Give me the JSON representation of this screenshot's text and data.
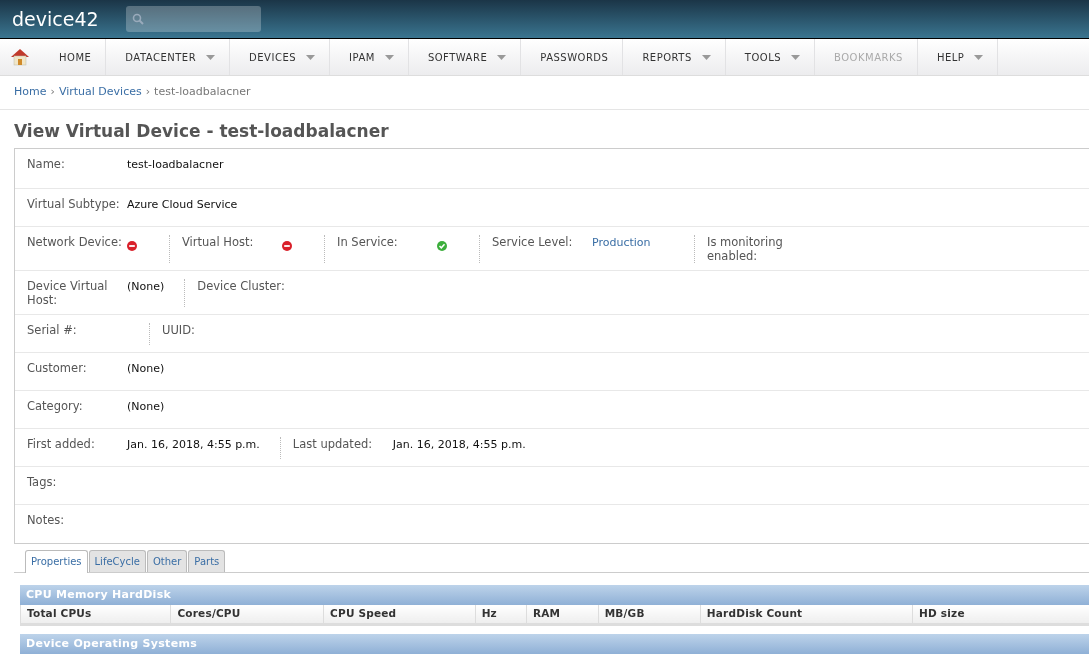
{
  "header": {
    "logo": "device42"
  },
  "nav": [
    {
      "label": "HOME",
      "dropdown": false,
      "disabled": false
    },
    {
      "label": "DATACENTER",
      "dropdown": true,
      "disabled": false
    },
    {
      "label": "DEVICES",
      "dropdown": true,
      "disabled": false
    },
    {
      "label": "IPAM",
      "dropdown": true,
      "disabled": false
    },
    {
      "label": "SOFTWARE",
      "dropdown": true,
      "disabled": false
    },
    {
      "label": "PASSWORDS",
      "dropdown": false,
      "disabled": false
    },
    {
      "label": "REPORTS",
      "dropdown": true,
      "disabled": false
    },
    {
      "label": "TOOLS",
      "dropdown": true,
      "disabled": false
    },
    {
      "label": "BOOKMARKS",
      "dropdown": false,
      "disabled": true
    },
    {
      "label": "HELP",
      "dropdown": true,
      "disabled": false
    }
  ],
  "breadcrumb": [
    {
      "label": "Home",
      "kind": "link"
    },
    {
      "label": "›",
      "kind": "separator"
    },
    {
      "label": "Virtual Devices",
      "kind": "link"
    },
    {
      "label": "›",
      "kind": "separator"
    },
    {
      "label": "test-loadbalacner",
      "kind": "current"
    }
  ],
  "title": "View Virtual Device - test-loadbalacner",
  "field_rows": [
    [
      {
        "label": "Name:",
        "kind": "text",
        "value": "test-loadbalacner"
      }
    ],
    [
      {
        "label": "Virtual Subtype:",
        "kind": "text",
        "value": "Azure Cloud Service"
      }
    ],
    [
      {
        "label": "Network Device:",
        "kind": "flag",
        "on": false
      },
      {
        "label": "Virtual Host:",
        "kind": "flag",
        "on": false
      },
      {
        "label": "In Service:",
        "kind": "flag",
        "on": true
      },
      {
        "label": "Service Level:",
        "kind": "link",
        "value": "Production"
      },
      {
        "label": "Is monitoring enabled:",
        "kind": "empty"
      }
    ],
    [
      {
        "label": "Device Virtual Host:",
        "kind": "text",
        "value": "(None)"
      },
      {
        "label": "Device Cluster:",
        "kind": "empty"
      }
    ],
    [
      {
        "label": "Serial #:",
        "kind": "empty"
      },
      {
        "label": "UUID:",
        "kind": "empty"
      }
    ],
    [
      {
        "label": "Customer:",
        "kind": "text",
        "value": "(None)"
      }
    ],
    [
      {
        "label": "Category:",
        "kind": "text",
        "value": "(None)"
      }
    ],
    [
      {
        "label": "First added:",
        "kind": "text",
        "value": "Jan. 16, 2018, 4:55 p.m."
      },
      {
        "label": "Last updated:",
        "kind": "text",
        "value": "Jan. 16, 2018, 4:55 p.m."
      }
    ],
    [
      {
        "label": "Tags:",
        "kind": "empty"
      }
    ],
    [
      {
        "label": "Notes:",
        "kind": "empty"
      }
    ]
  ],
  "tabs": [
    {
      "label": "Properties",
      "selected": true
    },
    {
      "label": "LifeCycle",
      "selected": false
    },
    {
      "label": "Other",
      "selected": false
    },
    {
      "label": "Parts",
      "selected": false
    }
  ],
  "sections": [
    {
      "title": "CPU Memory HardDisk",
      "columns": [
        "Total CPUs",
        "Cores/CPU",
        "CPU Speed",
        "Hz",
        "RAM",
        "MB/GB",
        "HardDisk Count",
        "HD size"
      ]
    },
    {
      "title": "Device Operating Systems"
    }
  ]
}
